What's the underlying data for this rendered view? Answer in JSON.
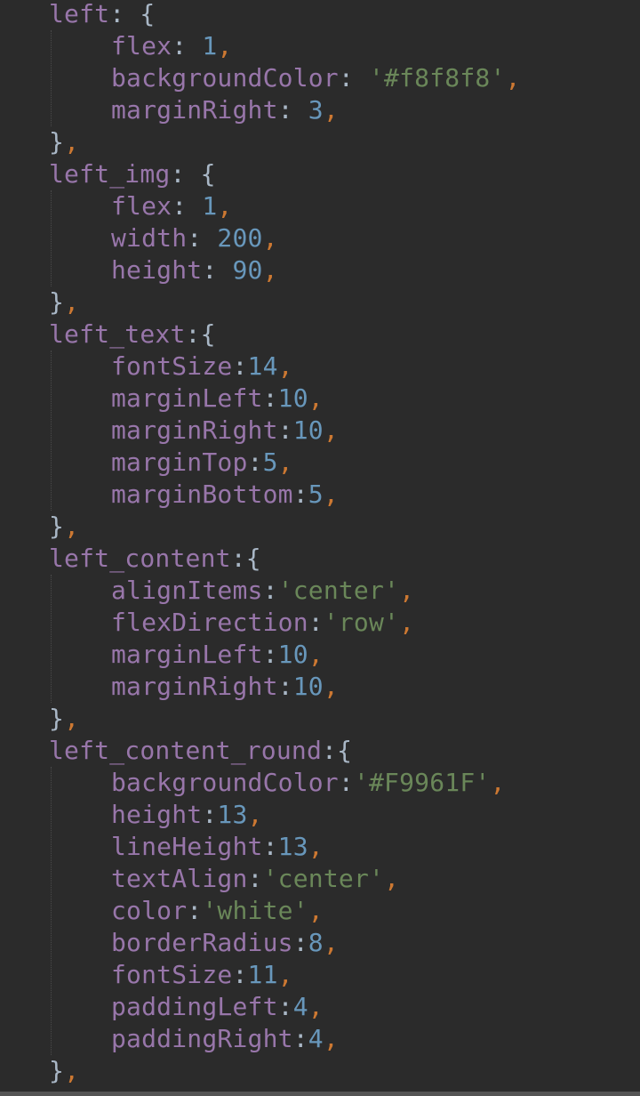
{
  "theme": {
    "background": "#2b2b2b",
    "key": "#9876aa",
    "punct": "#a9b7c6",
    "number": "#6897bb",
    "string": "#6a8759",
    "comma": "#cc7832"
  },
  "blocks": [
    {
      "name": "left",
      "closing": "},",
      "props": [
        {
          "key": "flex",
          "sep": ": ",
          "value": "1",
          "type": "number"
        },
        {
          "key": "backgroundColor",
          "sep": ": ",
          "value": "'#f8f8f8'",
          "type": "string"
        },
        {
          "key": "marginRight",
          "sep": ": ",
          "value": "3",
          "type": "number"
        }
      ]
    },
    {
      "name": "left_img",
      "closing": "},",
      "props": [
        {
          "key": "flex",
          "sep": ": ",
          "value": "1",
          "type": "number"
        },
        {
          "key": "width",
          "sep": ": ",
          "value": "200",
          "type": "number"
        },
        {
          "key": "height",
          "sep": ": ",
          "value": "90",
          "type": "number"
        }
      ]
    },
    {
      "name": "left_text",
      "closing": "},",
      "props": [
        {
          "key": "fontSize",
          "sep": ":",
          "value": "14",
          "type": "number"
        },
        {
          "key": "marginLeft",
          "sep": ":",
          "value": "10",
          "type": "number"
        },
        {
          "key": "marginRight",
          "sep": ":",
          "value": "10",
          "type": "number"
        },
        {
          "key": "marginTop",
          "sep": ":",
          "value": "5",
          "type": "number"
        },
        {
          "key": "marginBottom",
          "sep": ":",
          "value": "5",
          "type": "number"
        }
      ]
    },
    {
      "name": "left_content",
      "closing": "},",
      "props": [
        {
          "key": "alignItems",
          "sep": ":",
          "value": "'center'",
          "type": "string"
        },
        {
          "key": "flexDirection",
          "sep": ":",
          "value": "'row'",
          "type": "string"
        },
        {
          "key": "marginLeft",
          "sep": ":",
          "value": "10",
          "type": "number"
        },
        {
          "key": "marginRight",
          "sep": ":",
          "value": "10",
          "type": "number"
        }
      ]
    },
    {
      "name": "left_content_round",
      "closing": "},",
      "props": [
        {
          "key": "backgroundColor",
          "sep": ":",
          "value": "'#F9961F'",
          "type": "string"
        },
        {
          "key": "height",
          "sep": ":",
          "value": "13",
          "type": "number"
        },
        {
          "key": "lineHeight",
          "sep": ":",
          "value": "13",
          "type": "number"
        },
        {
          "key": "textAlign",
          "sep": ":",
          "value": "'center'",
          "type": "string"
        },
        {
          "key": "color",
          "sep": ":",
          "value": "'white'",
          "type": "string"
        },
        {
          "key": "borderRadius",
          "sep": ":",
          "value": "8",
          "type": "number"
        },
        {
          "key": "fontSize",
          "sep": ":",
          "value": "11",
          "type": "number"
        },
        {
          "key": "paddingLeft",
          "sep": ":",
          "value": "4",
          "type": "number"
        },
        {
          "key": "paddingRight",
          "sep": ":",
          "value": "4",
          "type": "number"
        }
      ]
    }
  ]
}
